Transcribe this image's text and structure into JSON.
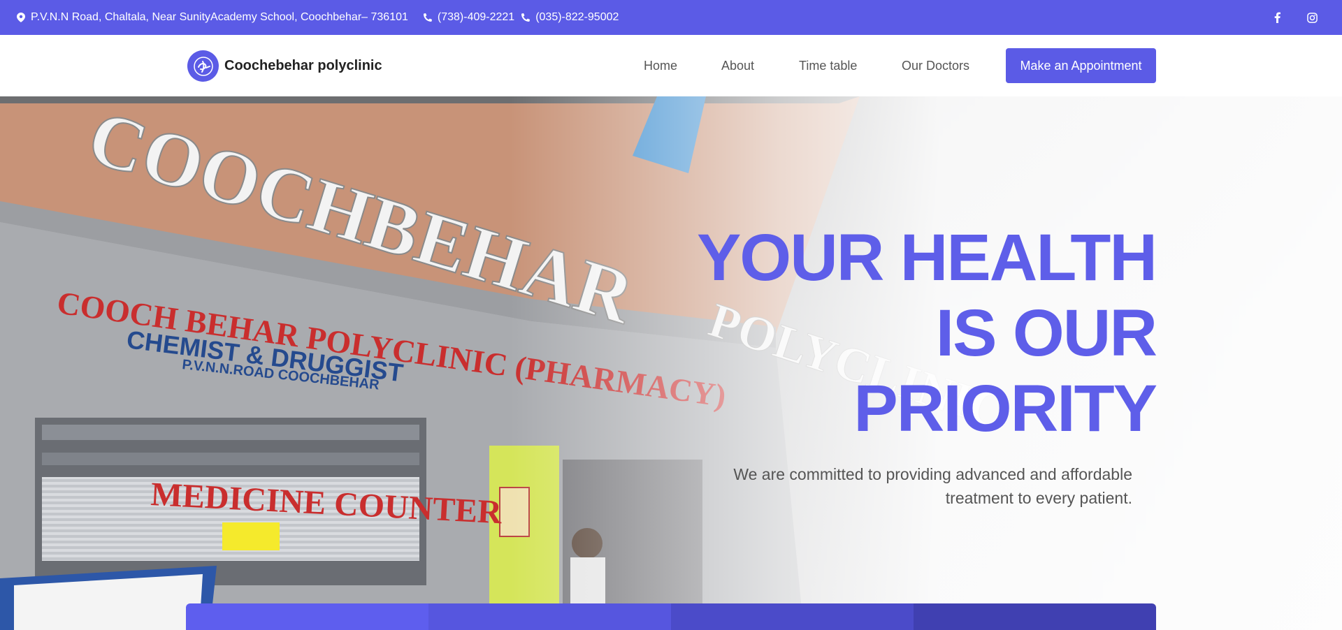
{
  "topbar": {
    "address": "P.V.N.N Road, Chaltala, Near SunityAcademy School, Coochbehar– 736101",
    "phone1": "(738)-409-2221",
    "phone2": "(035)-822-95002",
    "icons": [
      "map-pin-icon",
      "phone-icon",
      "phone-icon",
      "facebook-icon",
      "instagram-icon"
    ],
    "bg_color": "#5b5be6"
  },
  "header": {
    "brand_name": "Coochebehar polyclinic",
    "nav": [
      "Home",
      "About",
      "Time table",
      "Our Doctors"
    ],
    "cta_label": "Make an Appointment",
    "accent": "#5b5be6"
  },
  "hero": {
    "headline": [
      "YOUR HEALTH",
      "IS OUR",
      "PRIORITY"
    ],
    "subtitle": "We are committed to providing advanced and affordable treatment to every patient.",
    "headline_color": "#5e5ee9",
    "bar_colors": [
      "#5e5eee",
      "#5656df",
      "#4b4bc9",
      "#4040b1"
    ]
  }
}
